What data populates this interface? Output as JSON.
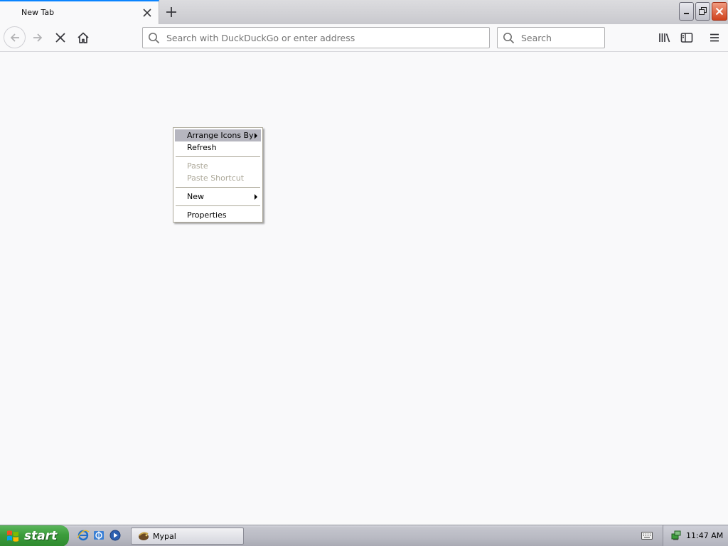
{
  "browser": {
    "tab": {
      "title": "New Tab"
    },
    "urlbar": {
      "placeholder": "Search with DuckDuckGo or enter address"
    },
    "searchbar": {
      "placeholder": "Search"
    }
  },
  "context_menu": {
    "items": [
      {
        "label": "Arrange Icons By",
        "submenu": true,
        "highlighted": true
      },
      {
        "label": "Refresh"
      },
      {
        "label": "Paste",
        "disabled": true
      },
      {
        "label": "Paste Shortcut",
        "disabled": true
      },
      {
        "label": "New",
        "submenu": true
      },
      {
        "label": "Properties"
      }
    ]
  },
  "taskbar": {
    "start_label": "start",
    "window_button": "Mypal",
    "clock": "11:47 AM"
  }
}
